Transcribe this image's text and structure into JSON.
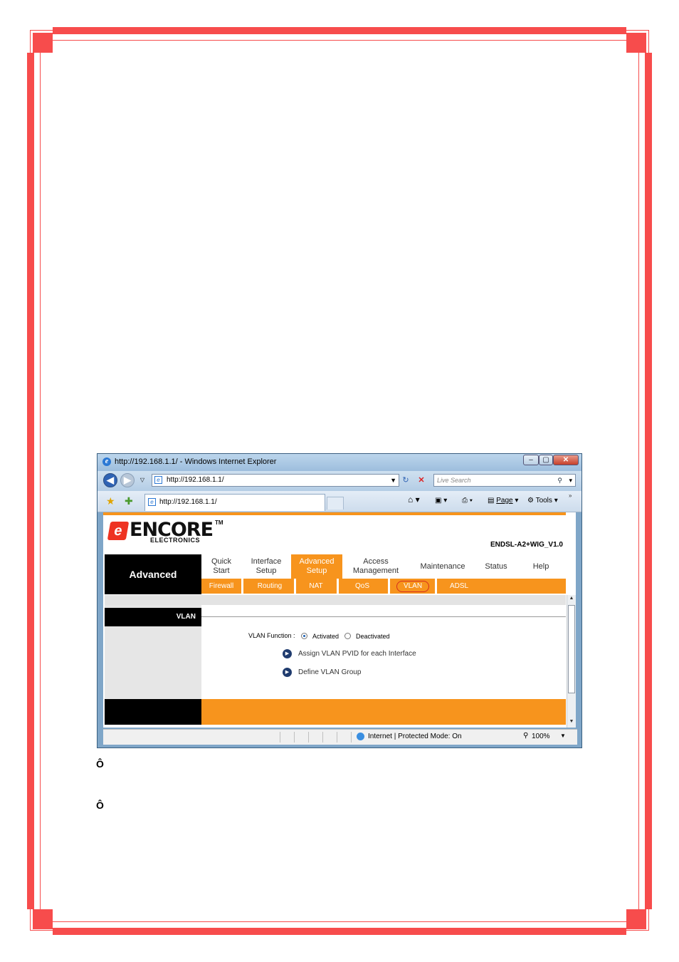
{
  "window": {
    "title": "http://192.168.1.1/ - Windows Internet Explorer",
    "address": "http://192.168.1.1/",
    "search_placeholder": "Live Search",
    "tab_label": "http://192.168.1.1/",
    "commands": {
      "page": "Page",
      "tools": "Tools"
    }
  },
  "router": {
    "logo": {
      "main": "ENCORE",
      "tm": "TM",
      "sub": "ELECTRONICS",
      "badge": "e"
    },
    "model": "ENDSL-A2+WIG_V1.0",
    "section": "Advanced",
    "menu": [
      {
        "label": "Quick\nStart",
        "active": false
      },
      {
        "label": "Interface\nSetup",
        "active": false
      },
      {
        "label": "Advanced\nSetup",
        "active": true
      },
      {
        "label": "Access\nManagement",
        "active": false
      },
      {
        "label": "Maintenance",
        "active": false
      },
      {
        "label": "Status",
        "active": false
      },
      {
        "label": "Help",
        "active": false
      }
    ],
    "submenu": [
      "Firewall",
      "Routing",
      "NAT",
      "QoS",
      "VLAN",
      "ADSL"
    ],
    "submenu_selected": "VLAN",
    "panel_title": "VLAN",
    "vlan_function_label": "VLAN Function :",
    "options": {
      "activated": "Activated",
      "deactivated": "Deactivated",
      "selected": "Activated"
    },
    "links": [
      "Assign VLAN PVID for each Interface",
      "Define VLAN Group"
    ]
  },
  "statusbar": {
    "zone": "Internet | Protected Mode: On",
    "zoom": "100%"
  },
  "page_bullets": [
    "Ô",
    "Ô"
  ],
  "colors": {
    "frame": "#f74c4c",
    "accent": "#f7941d",
    "brand_red": "#e32222"
  }
}
